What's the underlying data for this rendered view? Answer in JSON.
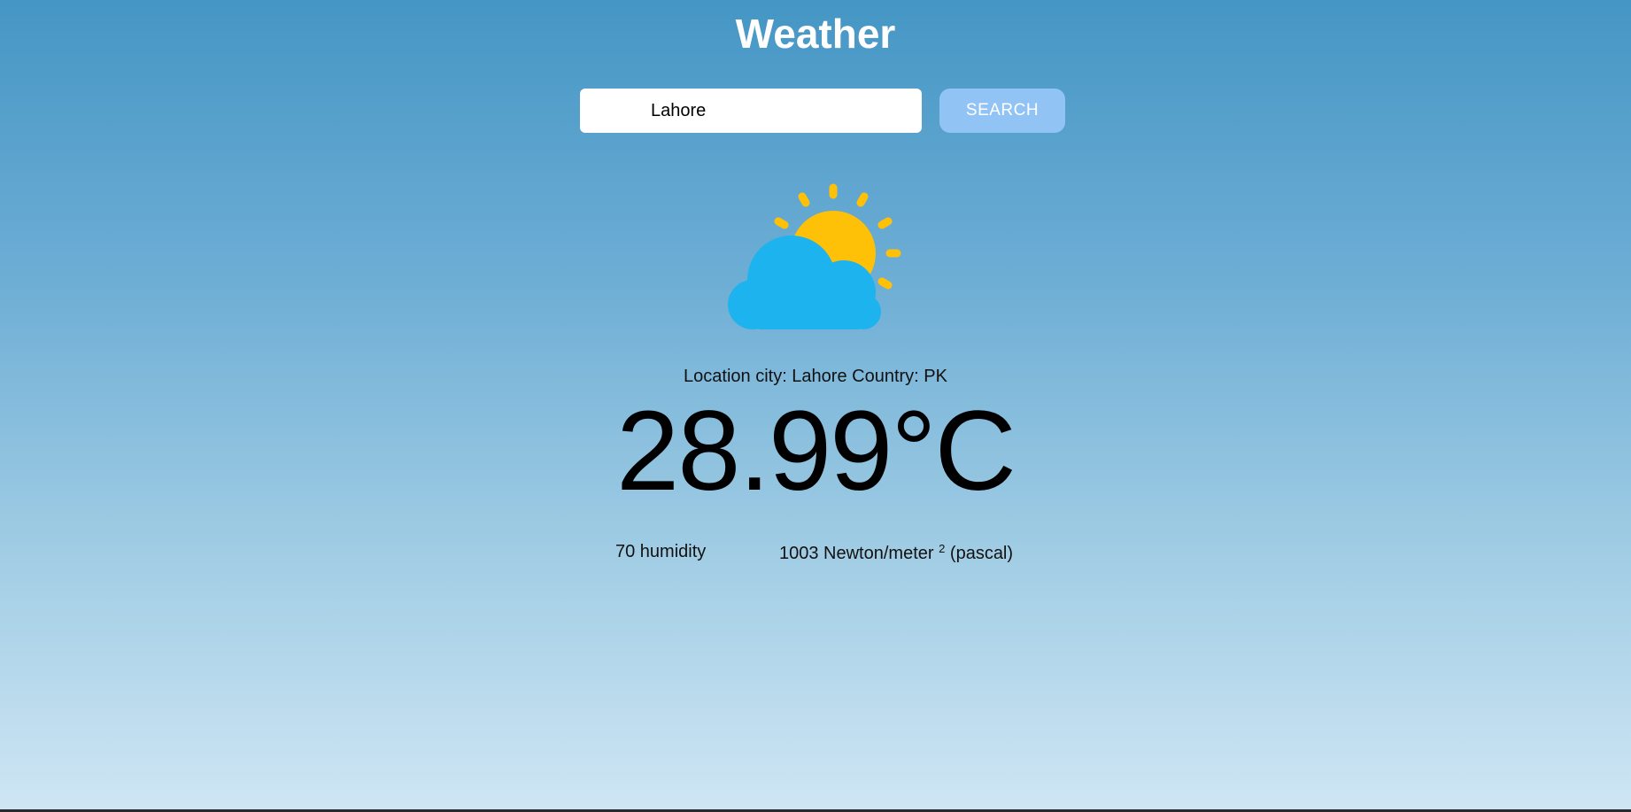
{
  "header": {
    "title": "Weather"
  },
  "search": {
    "value": "Lahore",
    "button_label": "SEARCH"
  },
  "weather": {
    "icon": "partly-cloudy-icon",
    "location_text": "Location city: Lahore Country: PK",
    "temperature": "28.99",
    "temperature_unit": "°C",
    "humidity_text": "70 humidity",
    "pressure_value": "1003 Newton/meter",
    "pressure_superscript": "2",
    "pressure_suffix": "(pascal)"
  },
  "colors": {
    "sun": "#ffc107",
    "cloud": "#1cb3ee",
    "search_button": "#91c4f5"
  }
}
